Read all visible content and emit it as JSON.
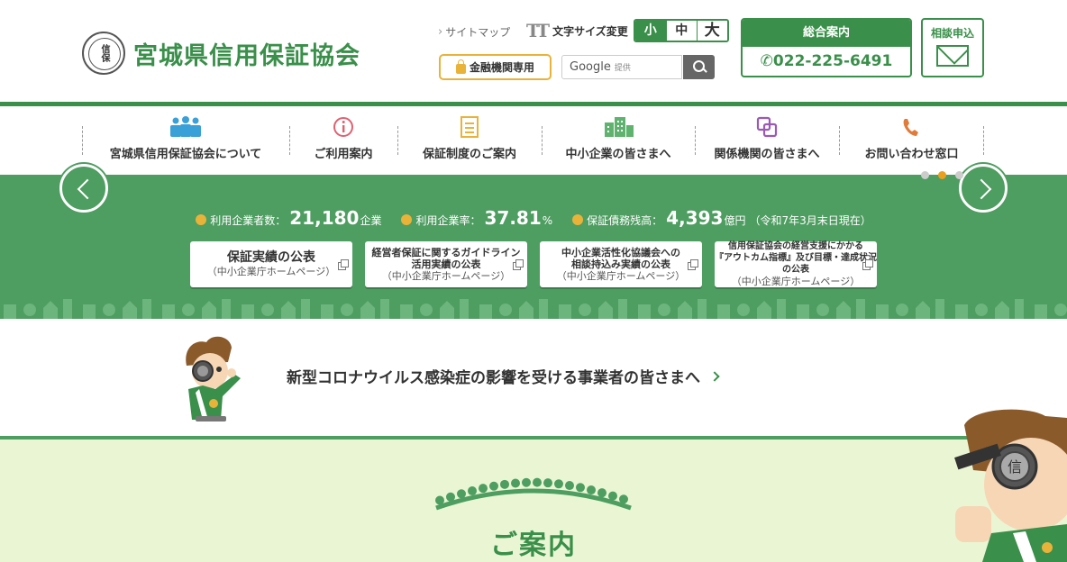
{
  "header": {
    "logo_mark_text": "信保",
    "logo_text": "宮城県信用保証協会",
    "sitemap_label": "サイトマップ",
    "font_size_label": "文字サイズ変更",
    "font_sizes": [
      "小",
      "中",
      "大"
    ],
    "kinyu_label": "金融機関専用",
    "search_placeholder": "Google",
    "search_provided": "提供",
    "soudan_title": "総合案内",
    "soudan_tel": "022-225-6491",
    "mail_label": "相談申込"
  },
  "nav": {
    "items": [
      {
        "label": "宮城県信用保証協会について",
        "icon": "people-icon",
        "color": "#3aa0d8"
      },
      {
        "label": "ご利用案内",
        "icon": "info-icon",
        "color": "#e06070"
      },
      {
        "label": "保証制度のご案内",
        "icon": "document-icon",
        "color": "#e9b33a"
      },
      {
        "label": "中小企業の皆さまへ",
        "icon": "building-icon",
        "color": "#5fb36e"
      },
      {
        "label": "関係機関の皆さまへ",
        "icon": "link-icon",
        "color": "#9b59b6"
      },
      {
        "label": "お問い合わせ窓口",
        "icon": "phone-icon",
        "color": "#e07b39"
      }
    ]
  },
  "banner": {
    "stats": [
      {
        "label": "利用企業者数：",
        "value": "21,180",
        "unit": "企業"
      },
      {
        "label": "利用企業率：",
        "value": "37.81",
        "unit": "%"
      },
      {
        "label": "保証債務残高：",
        "value": "4,393",
        "unit": "億円",
        "note": "（令和7年3月末日現在）"
      }
    ],
    "cards": [
      {
        "title": "保証実績の公表",
        "sub": "（中小企業庁ホームページ）"
      },
      {
        "title": "経営者保証に関するガイドライン\n活用実績の公表",
        "sub": "（中小企業庁ホームページ）"
      },
      {
        "title": "中小企業活性化協議会への\n相談持込み実績の公表",
        "sub": "（中小企業庁ホームページ）"
      },
      {
        "title": "信用保証協会の経営支援にかかる\n『アウトカム指標』及び目標・達成状況の公表",
        "sub": "（中小企業庁ホームページ）"
      }
    ],
    "slide_count": 3,
    "active_slide": 2
  },
  "corona": {
    "link_text": "新型コロナウイルス感染症の影響を受ける事業者の皆さまへ"
  },
  "guide": {
    "title": "ご案内"
  },
  "colors": {
    "brand_green": "#3a8f4a",
    "banner_green": "#4e9d61",
    "accent_yellow": "#e9b33a",
    "guide_bg": "#eaf6d3"
  }
}
